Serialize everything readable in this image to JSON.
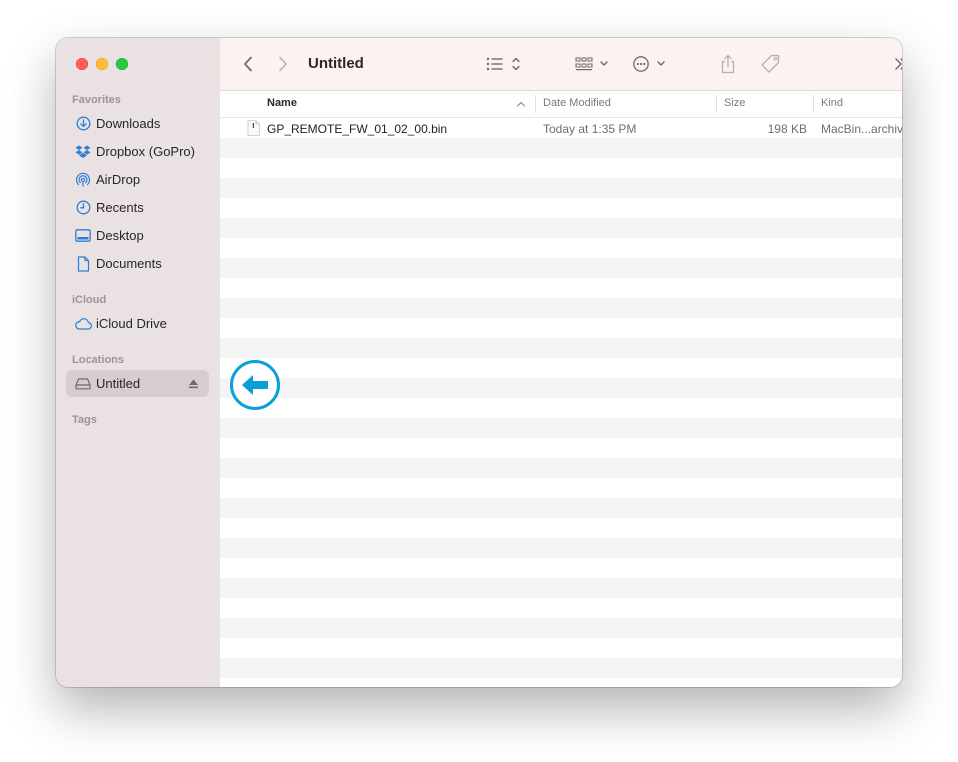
{
  "window": {
    "title": "Untitled"
  },
  "sidebar": {
    "sections": {
      "favorites": "Favorites",
      "icloud": "iCloud",
      "locations": "Locations",
      "tags": "Tags"
    },
    "favorites": [
      {
        "label": "Downloads",
        "icon": "download-icon"
      },
      {
        "label": "Dropbox (GoPro)",
        "icon": "dropbox-icon"
      },
      {
        "label": "AirDrop",
        "icon": "airdrop-icon"
      },
      {
        "label": "Recents",
        "icon": "clock-icon"
      },
      {
        "label": "Desktop",
        "icon": "desktop-icon"
      },
      {
        "label": "Documents",
        "icon": "document-icon"
      }
    ],
    "icloud": [
      {
        "label": "iCloud Drive",
        "icon": "cloud-icon"
      }
    ],
    "locations": [
      {
        "label": "Untitled",
        "icon": "drive-icon",
        "selected": true
      }
    ]
  },
  "columns": {
    "name": "Name",
    "date_modified": "Date Modified",
    "size": "Size",
    "kind": "Kind"
  },
  "files": [
    {
      "name": "GP_REMOTE_FW_01_02_00.bin",
      "date_modified": "Today at 1:35 PM",
      "size": "198 KB",
      "kind": "MacBin...archive"
    }
  ],
  "colors": {
    "sidebar_bg": "#e9e1e2",
    "toolbar_bg": "#fcf2f2",
    "accent": "#0a9fd9",
    "icon_blue": "#2d7fd3"
  }
}
